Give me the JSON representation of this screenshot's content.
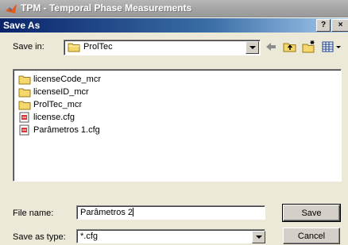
{
  "parent_window": {
    "title": "TPM - Temporal Phase Measurements"
  },
  "dialog": {
    "title": "Save As",
    "help_label": "?",
    "close_label": "×"
  },
  "save_in": {
    "label": "Save in:",
    "value": "ProlTec"
  },
  "toolbar": [
    "back-icon",
    "up-folder-icon",
    "new-folder-icon",
    "views-icon"
  ],
  "files": [
    {
      "name": "licenseCode_mcr",
      "type": "folder"
    },
    {
      "name": "licenseID_mcr",
      "type": "folder"
    },
    {
      "name": "ProlTec_mcr",
      "type": "folder"
    },
    {
      "name": "license.cfg",
      "type": "file"
    },
    {
      "name": "Parâmetros 1.cfg",
      "type": "file"
    }
  ],
  "file_name": {
    "label": "File name:",
    "value": "Parâmetros 2"
  },
  "save_as_type": {
    "label": "Save as type:",
    "value": "*.cfg"
  },
  "buttons": {
    "save": "Save",
    "cancel": "Cancel"
  },
  "colors": {
    "dialog_title_start": "#0a246a",
    "dialog_title_end": "#a6caf0",
    "face": "#ece9d8",
    "folder": "#f5d76e"
  }
}
